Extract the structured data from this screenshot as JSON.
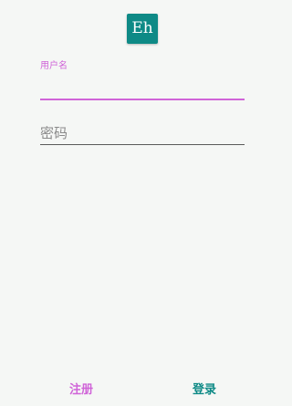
{
  "logo": {
    "text": "Eh"
  },
  "username": {
    "label": "用户名",
    "value": ""
  },
  "password": {
    "placeholder": "密码",
    "value": ""
  },
  "buttons": {
    "register": "注册",
    "login": "登录"
  },
  "colors": {
    "accent": "#d064d8",
    "primary": "#0e8a86",
    "background": "#f5f7f5"
  }
}
